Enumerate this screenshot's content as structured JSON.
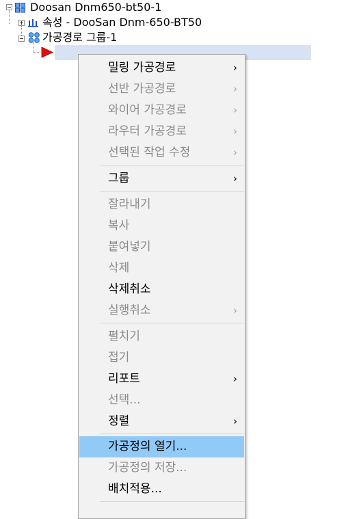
{
  "tree": {
    "root_label": "Doosan Dnm650-bt50-1",
    "properties_label": "속성 - DooSan Dnm-650-BT50",
    "group_label": "가공경로 그룹-1",
    "selected_item_label": ""
  },
  "context_menu": {
    "items": [
      {
        "label": "밀링 가공경로",
        "enabled": true,
        "submenu": true
      },
      {
        "label": "선반 가공경로",
        "enabled": false,
        "submenu": true
      },
      {
        "label": "와이어 가공경로",
        "enabled": false,
        "submenu": true
      },
      {
        "label": "라우터 가공경로",
        "enabled": false,
        "submenu": true
      },
      {
        "label": "선택된 작업 수정",
        "enabled": false,
        "submenu": true
      },
      {
        "label": "그룹",
        "enabled": true,
        "submenu": true
      },
      {
        "label": "잘라내기",
        "enabled": false,
        "submenu": false
      },
      {
        "label": "복사",
        "enabled": false,
        "submenu": false
      },
      {
        "label": "붙여넣기",
        "enabled": false,
        "submenu": false
      },
      {
        "label": "삭제",
        "enabled": false,
        "submenu": false
      },
      {
        "label": "삭제취소",
        "enabled": true,
        "submenu": false
      },
      {
        "label": "실행취소",
        "enabled": false,
        "submenu": true
      },
      {
        "label": "펼치기",
        "enabled": false,
        "submenu": false
      },
      {
        "label": "접기",
        "enabled": false,
        "submenu": false
      },
      {
        "label": "리포트",
        "enabled": true,
        "submenu": true
      },
      {
        "label": "선택...",
        "enabled": false,
        "submenu": false
      },
      {
        "label": "정렬",
        "enabled": true,
        "submenu": true
      },
      {
        "label": "가공정의 열기...",
        "enabled": true,
        "submenu": false,
        "highlighted": true
      },
      {
        "label": "가공정의 저장...",
        "enabled": false,
        "submenu": false
      },
      {
        "label": "배치적용...",
        "enabled": true,
        "submenu": false
      }
    ],
    "submenu_arrow": "›"
  },
  "colors": {
    "highlight": "#91c9f7",
    "selection_bar": "#d7e2f3",
    "disabled_text": "#8a8a8a",
    "tree_link_blue": "#1e50c8",
    "arrow_red": "#e01010"
  }
}
